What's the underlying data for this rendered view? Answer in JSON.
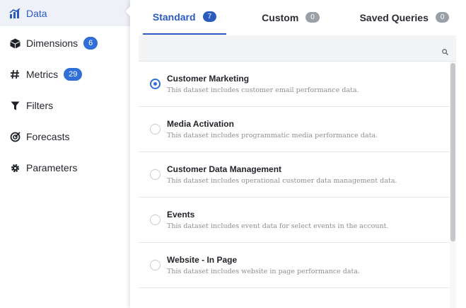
{
  "sidebar": {
    "items": [
      {
        "label": "Data",
        "icon": "chart-icon",
        "badge": null,
        "active": true
      },
      {
        "label": "Dimensions",
        "icon": "cube-icon",
        "badge": "6"
      },
      {
        "label": "Metrics",
        "icon": "hash-icon",
        "badge": "29"
      },
      {
        "label": "Filters",
        "icon": "filter-icon",
        "badge": null
      },
      {
        "label": "Forecasts",
        "icon": "forecast-icon",
        "badge": null
      },
      {
        "label": "Parameters",
        "icon": "gear-icon",
        "badge": null
      }
    ]
  },
  "tabs": [
    {
      "label": "Standard",
      "count": "7",
      "active": true
    },
    {
      "label": "Custom",
      "count": "0"
    },
    {
      "label": "Saved Queries",
      "count": "0"
    }
  ],
  "search": {
    "placeholder": "",
    "value": "",
    "icon": "search-icon"
  },
  "datasets": [
    {
      "title": "Customer Marketing",
      "desc": "This dataset includes customer email performance data.",
      "selected": true
    },
    {
      "title": "Media Activation",
      "desc": "This dataset includes programmatic media performance data."
    },
    {
      "title": "Customer Data Management",
      "desc": "This dataset includes operational customer data management data."
    },
    {
      "title": "Events",
      "desc": "This dataset includes event data for select events in the account."
    },
    {
      "title": "Website - In Page",
      "desc": "This dataset includes website in page performance data."
    }
  ],
  "colors": {
    "accent": "#2c5bbf",
    "badge": "#2f6fd6",
    "muted_badge": "#9aa0a8"
  }
}
